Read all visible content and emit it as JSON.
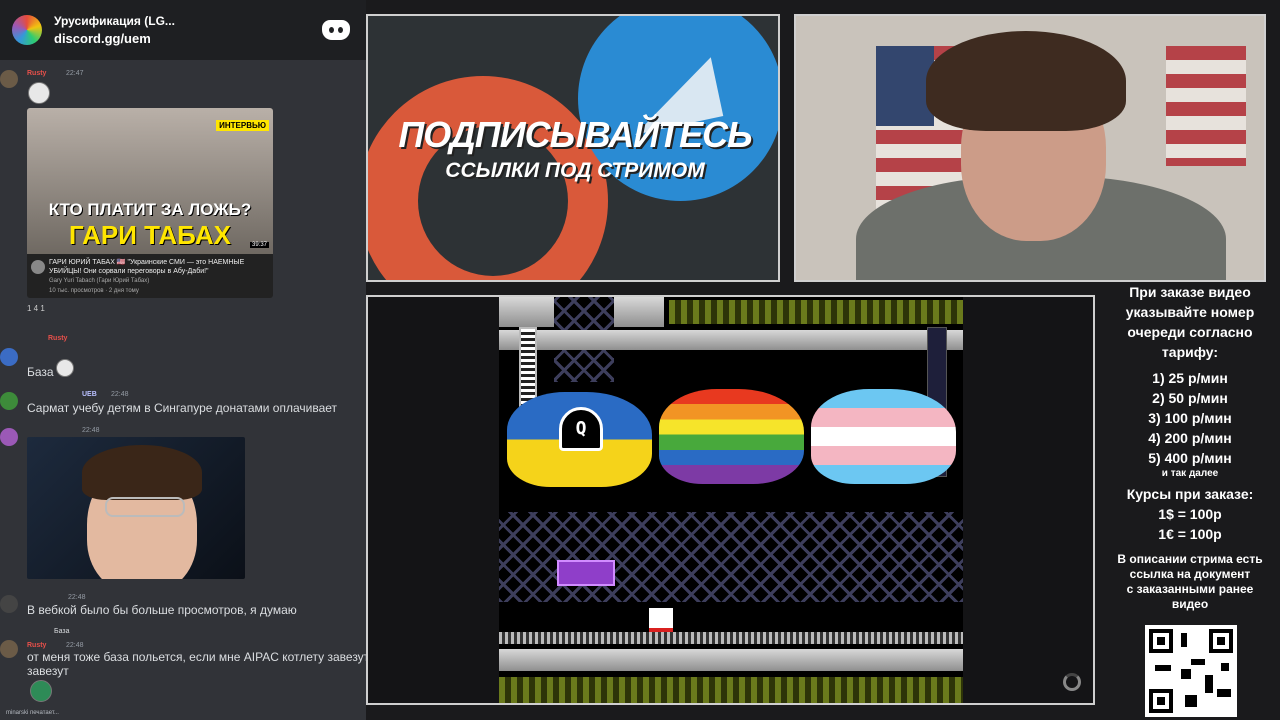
{
  "chat": {
    "server_name": "Урусификация (LG...",
    "invite": "discord.gg/uem",
    "messages": [
      {
        "user": "Rusty",
        "time": "22:47"
      },
      {
        "user": "Rusty",
        "text": "База"
      },
      {
        "user": "UEB",
        "time": "22:48",
        "text": "Сармат учебу детям в Сингапуре донатами оплачивает"
      },
      {
        "time": "22:48"
      },
      {
        "time": "22:48",
        "text": "В вебкой было бы больше просмотров, я думаю"
      },
      {
        "user": "Rusty",
        "time": "22:48",
        "reply": "База",
        "text": "от меня тоже база польется, если мне AIPAC котлету завезут"
      }
    ],
    "youtube": {
      "badge": "ИНТЕРВЬЮ",
      "headline1": "КТО ПЛАТИТ ЗА ЛОЖЬ?",
      "headline2": "ГАРИ ТАБАХ",
      "duration": "39:37",
      "title": "ГАРИ ЮРИЙ ТАБАХ 🇺🇸 \"Украинские СМИ — это НАЕМНЫЕ УБИЙЦЫ! Они сорвали переговоры в Абу-Даби!\"",
      "author": "Gary Yuri Tabach (Гари Юрий Табах)",
      "views": "10 тыс. просмотров · 2 дня тому"
    },
    "reactions": "1   4   1",
    "typing": "minarski печатает..."
  },
  "promo": {
    "title": "ПОДПИСЫВАЙТЕСЬ",
    "subtitle": "ССЫЛКИ ПОД СТРИМОМ"
  },
  "game": {
    "boss_letter": "Q"
  },
  "info": {
    "intro": [
      "При заказе видео",
      "указывайте номер",
      "очереди согласно",
      "тарифу:"
    ],
    "tariffs": [
      "1) 25 р/мин",
      "2) 50 р/мин",
      "3) 100 р/мин",
      "4) 200 р/мин",
      "5) 400 р/мин"
    ],
    "etc": "и так далее",
    "rates_title": "Курсы при заказе:",
    "rates": [
      "1$ = 100р",
      "1€ = 100р"
    ],
    "desc": [
      "В описании стрима есть",
      "ссылка на документ",
      "с заказанными ранее",
      "видео"
    ]
  }
}
